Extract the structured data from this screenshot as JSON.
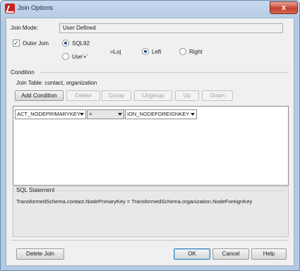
{
  "window": {
    "title": "Join Options",
    "close_symbol": "x"
  },
  "join_mode": {
    "label": "Join Mode:",
    "value": "User Defined"
  },
  "outer_join": {
    "label": "Outer Join",
    "checked": true
  },
  "syntax": {
    "sql92_label": "SQL92",
    "use_plus_label": "Use'+'",
    "selected": "SQL92"
  },
  "loj_label": "=Loj",
  "side": {
    "left_label": "Left",
    "right_label": "Right",
    "selected": "Left"
  },
  "condition": {
    "heading": "Condition",
    "join_table_label": "Join Table: contact, organization",
    "buttons": {
      "add_condition": "Add Condition",
      "delete": "Delete",
      "group": "Group",
      "ungroup": "Ungroup",
      "up": "Up",
      "down": "Down"
    },
    "row": {
      "left_field": "ACT_NODEPRIMARYKEY",
      "operator": "=",
      "right_field": "ION_NODEFOREIGNKEY"
    }
  },
  "sql_statement": {
    "heading": "SQL Statement",
    "text": "TransformedSchema.contact.NodePrimaryKey = TransformedSchema.organization.NodeForeignKey"
  },
  "footer": {
    "delete_join": "Delete Join",
    "ok": "OK",
    "cancel": "Cancel",
    "help": "Help"
  }
}
